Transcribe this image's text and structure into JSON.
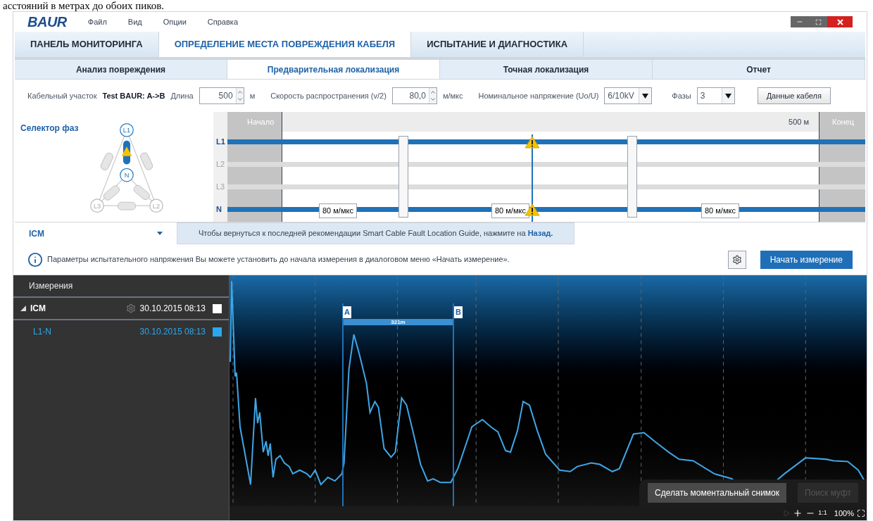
{
  "doc_caption": "асстояний в метрах до обоих пиков.",
  "app": {
    "logo": "BAUR",
    "menu": [
      "Файл",
      "Вид",
      "Опции",
      "Справка"
    ]
  },
  "main_tabs": [
    {
      "label": "ПАНЕЛЬ МОНИТОРИНГА",
      "selected": false
    },
    {
      "label": "ОПРЕДЕЛЕНИЕ МЕСТА ПОВРЕЖДЕНИЯ КАБЕЛЯ",
      "selected": true
    },
    {
      "label": "ИСПЫТАНИЕ И ДИАГНОСТИКА",
      "selected": false
    }
  ],
  "steps": [
    {
      "label": "Анализ повреждения",
      "selected": false
    },
    {
      "label": "Предварительная локализация",
      "selected": true
    },
    {
      "label": "Точная локализация",
      "selected": false
    },
    {
      "label": "Отчет",
      "selected": false
    }
  ],
  "params": {
    "section_label": "Кабельный участок",
    "section_value": "Test BAUR: A->B",
    "length_label": "Длина",
    "length_value": "500",
    "length_unit": "м",
    "speed_label": "Скорость распространения (v/2)",
    "speed_value": "80,0",
    "speed_unit": "м/мкс",
    "voltage_label": "Номинальное напряжение (Uo/U)",
    "voltage_value": "6/10kV",
    "phases_label": "Фазы",
    "phases_value": "3",
    "cable_data_button": "Данные кабеля"
  },
  "phase_selector": {
    "title": "Селектор фаз",
    "nodes": [
      "L1",
      "N",
      "L3",
      "L2"
    ]
  },
  "cable_diagram": {
    "start_label": "Начало",
    "end_distance": "500 м",
    "end_label": "Конец",
    "lines": [
      {
        "label": "L1",
        "active": true
      },
      {
        "label": "L2",
        "active": false
      },
      {
        "label": "L3",
        "active": false
      },
      {
        "label": "N",
        "active": true
      }
    ],
    "speed_tags": [
      "80 м/мкс",
      "80 м/мкс",
      "80 м/мкс"
    ]
  },
  "method": {
    "name": "ICM",
    "hint": "Чтобы вернуться к последней рекомендации Smart Cable Fault Location Guide, нажмите на",
    "back_link": "Назад."
  },
  "info": {
    "text": "Параметры испытательного напряжения Вы можете установить до начала измерения в диалоговом меню «Начать измерение».",
    "start_button": "Начать измерение"
  },
  "measurements": {
    "title": "Измерения",
    "items": [
      {
        "name": "ICM",
        "date": "30.10.2015 08:13",
        "expanded": true,
        "selected": false,
        "color": "#ffffff",
        "children": [
          {
            "name": "L1-N",
            "date": "30.10.2015 08:13",
            "selected": true,
            "color": "#29a8f0"
          }
        ]
      }
    ]
  },
  "trace": {
    "cursor_a": "A",
    "cursor_b": "B",
    "distance": "321m"
  },
  "trace_actions": [
    {
      "label": "Сделать моментальный снимок",
      "disabled": false
    },
    {
      "label": "Поиск муфт",
      "disabled": true
    }
  ],
  "zoom": {
    "one_to_one": "1:1",
    "percent": "100%"
  }
}
